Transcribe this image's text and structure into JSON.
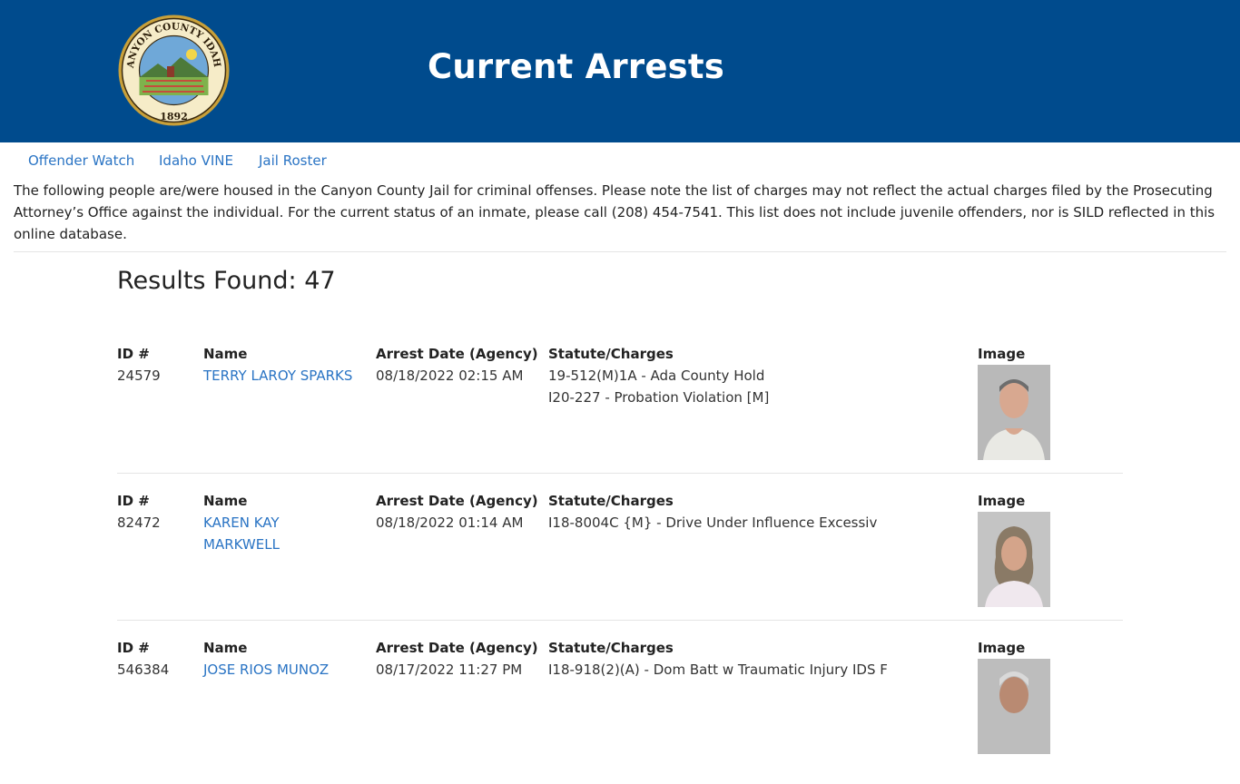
{
  "header": {
    "title": "Current Arrests",
    "seal": {
      "top_text": "CANYON COUNTY IDAHO",
      "year": "1892"
    }
  },
  "nav": {
    "links": [
      "Offender Watch",
      "Idaho VINE",
      "Jail Roster"
    ]
  },
  "intro": "The following people are/were housed in the Canyon County Jail for criminal offenses. Please note the list of charges may not reflect the actual charges filed by the Prosecuting Attorney’s Office against the individual. For the current status of an inmate, please call (208) 454-7541. This list does not include juvenile offenders, nor is SILD reflected in this online database.",
  "results_label": "Results Found: 47",
  "columns": {
    "id": "ID #",
    "name": "Name",
    "date": "Arrest Date (Agency)",
    "charges": "Statute/Charges",
    "image": "Image"
  },
  "records": [
    {
      "id": "24579",
      "name": "TERRY LAROY SPARKS",
      "date": "08/18/2022 02:15 AM",
      "charges": [
        "19-512(M)1A - Ada County Hold",
        "I20-227 - Probation Violation [M]"
      ]
    },
    {
      "id": "82472",
      "name": "KAREN KAY MARKWELL",
      "date": "08/18/2022 01:14 AM",
      "charges": [
        "I18-8004C {M} - Drive Under Influence Excessiv"
      ]
    },
    {
      "id": "546384",
      "name": "JOSE RIOS MUNOZ",
      "date": "08/17/2022 11:27 PM",
      "charges": [
        "I18-918(2)(A) - Dom Batt w Traumatic Injury IDS F"
      ]
    }
  ],
  "colors": {
    "header_bg": "#004b8d",
    "link": "#2a74c4",
    "seal_gold": "#c8a03a"
  }
}
